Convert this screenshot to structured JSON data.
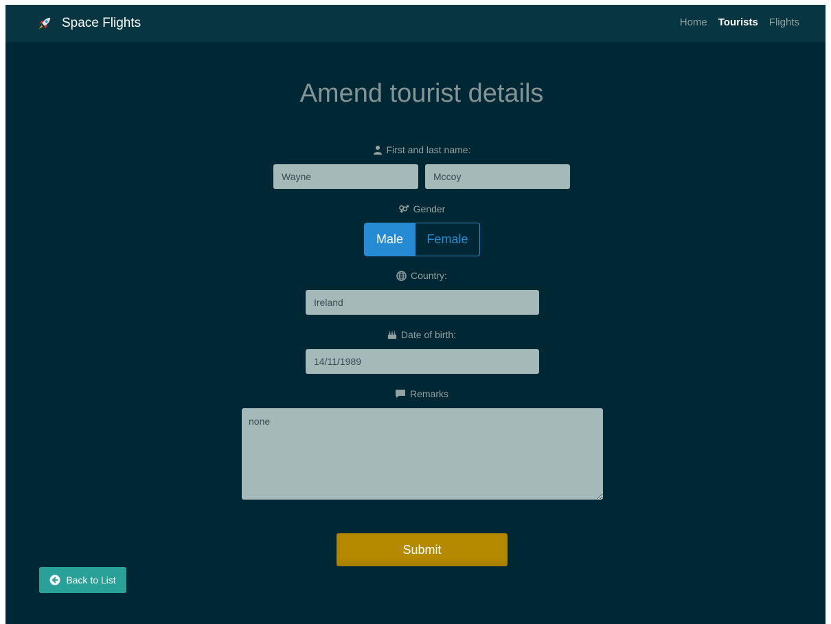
{
  "navbar": {
    "brand": "Space Flights",
    "links": [
      "Home",
      "Tourists",
      "Flights"
    ],
    "active_link": "Tourists"
  },
  "page": {
    "title": "Amend tourist details"
  },
  "form": {
    "name_label": "First and last name:",
    "first_name": "Wayne",
    "last_name": "Mccoy",
    "gender_label": "Gender",
    "gender_options": [
      "Male",
      "Female"
    ],
    "gender_selected": "Male",
    "country_label": "Country:",
    "country": "Ireland",
    "dob_label": "Date of birth:",
    "dob": "14/11/1989",
    "remarks_label": "Remarks",
    "remarks": "none",
    "submit_label": "Submit"
  },
  "back_button": {
    "label": "Back to List"
  },
  "icons": {
    "brand": "rocket-icon",
    "name": "user-icon",
    "gender": "venus-mars-icon",
    "country": "globe-icon",
    "dob": "birthday-cake-icon",
    "remarks": "comment-icon",
    "back": "arrow-circle-left-icon"
  },
  "colors": {
    "background": "#002734",
    "navbar": "#073642",
    "field": "#a6b9b9",
    "primary": "#268bd2",
    "submit": "#b58900",
    "back": "#2aa198"
  }
}
